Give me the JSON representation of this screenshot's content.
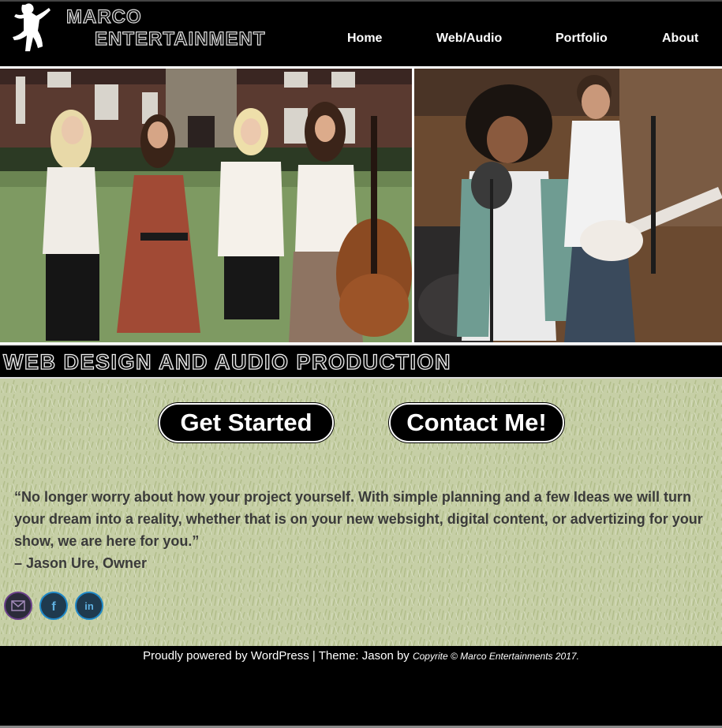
{
  "brand": {
    "line1": "MARCO",
    "line2": "ENTERTAINMENT"
  },
  "nav": {
    "home": "Home",
    "web_audio": "Web/Audio",
    "portfolio": "Portfolio",
    "about": "About"
  },
  "banner": {
    "text": "WEB DESIGN AND AUDIO PRODUCTION"
  },
  "buttons": {
    "get_started": "Get Started",
    "contact": "Contact Me!"
  },
  "quote": {
    "text": "“No longer worry about how your project yourself. With simple planning and a few Ideas we will turn your dream into a reality, whether that is on your new websight, digital content, or advertizing for your show, we are here for you.”",
    "author": "– Jason Ure, Owner"
  },
  "social": [
    {
      "icon": "mail-icon"
    },
    {
      "icon": "facebook-icon"
    },
    {
      "icon": "linkedin-icon"
    }
  ],
  "footer": {
    "powered": "Proudly powered by WordPress",
    "sep": "|",
    "theme": "Theme: Jason by",
    "copyright": "Copyrite © Marco Entertainments 2017."
  },
  "colors": {
    "background": "#000000",
    "content_bg": "#c9d2ac",
    "text_dark": "#3a3a3a",
    "accent_blue": "#1e88c8"
  }
}
